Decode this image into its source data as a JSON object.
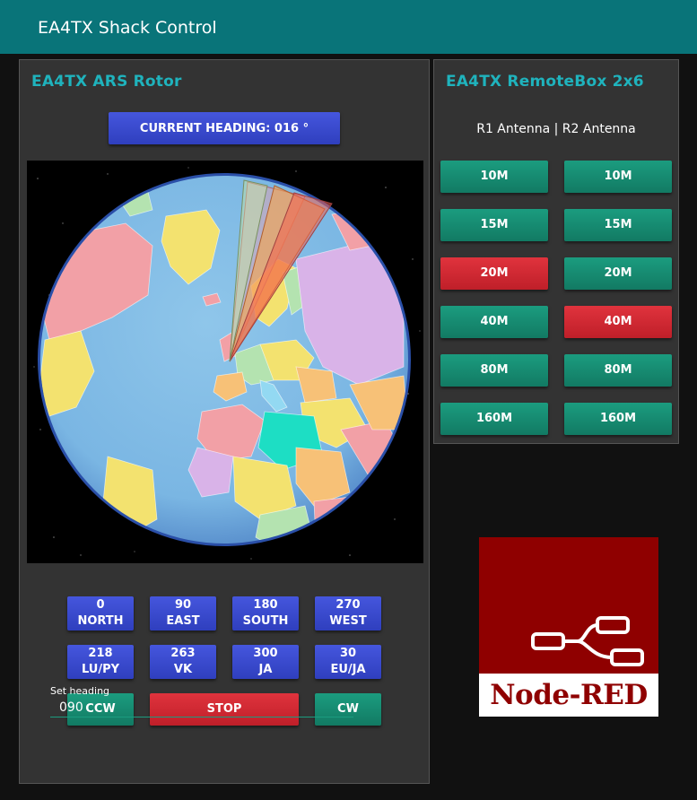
{
  "app": {
    "title": "EA4TX Shack Control"
  },
  "rotor": {
    "title": "EA4TX ARS Rotor",
    "heading_label": "CURRENT HEADING: 016 °",
    "presets": [
      {
        "value": "0",
        "label": "NORTH"
      },
      {
        "value": "90",
        "label": "EAST"
      },
      {
        "value": "180",
        "label": "SOUTH"
      },
      {
        "value": "270",
        "label": "WEST"
      },
      {
        "value": "218",
        "label": "LU/PY"
      },
      {
        "value": "263",
        "label": "VK"
      },
      {
        "value": "300",
        "label": "JA"
      },
      {
        "value": "30",
        "label": "EU/JA"
      }
    ],
    "ccw_label": "CCW",
    "stop_label": "STOP",
    "cw_label": "CW",
    "set_heading_label": "Set heading",
    "set_heading_value": "090"
  },
  "remotebox": {
    "title": "EA4TX RemoteBox 2x6",
    "subtitle": "R1 Antenna | R2 Antenna",
    "r1": [
      {
        "label": "10M",
        "active": false
      },
      {
        "label": "15M",
        "active": false
      },
      {
        "label": "20M",
        "active": true
      },
      {
        "label": "40M",
        "active": false
      },
      {
        "label": "80M",
        "active": false
      },
      {
        "label": "160M",
        "active": false
      }
    ],
    "r2": [
      {
        "label": "10M",
        "active": false
      },
      {
        "label": "15M",
        "active": false
      },
      {
        "label": "20M",
        "active": false
      },
      {
        "label": "40M",
        "active": true
      },
      {
        "label": "80M",
        "active": false
      },
      {
        "label": "160M",
        "active": false
      }
    ]
  },
  "logo": {
    "text": "Node-RED"
  },
  "colors": {
    "header": "#097479",
    "accent": "#1fb3bd",
    "blue": "#3b4bd0",
    "green": "#178c71",
    "red": "#d72a34"
  }
}
